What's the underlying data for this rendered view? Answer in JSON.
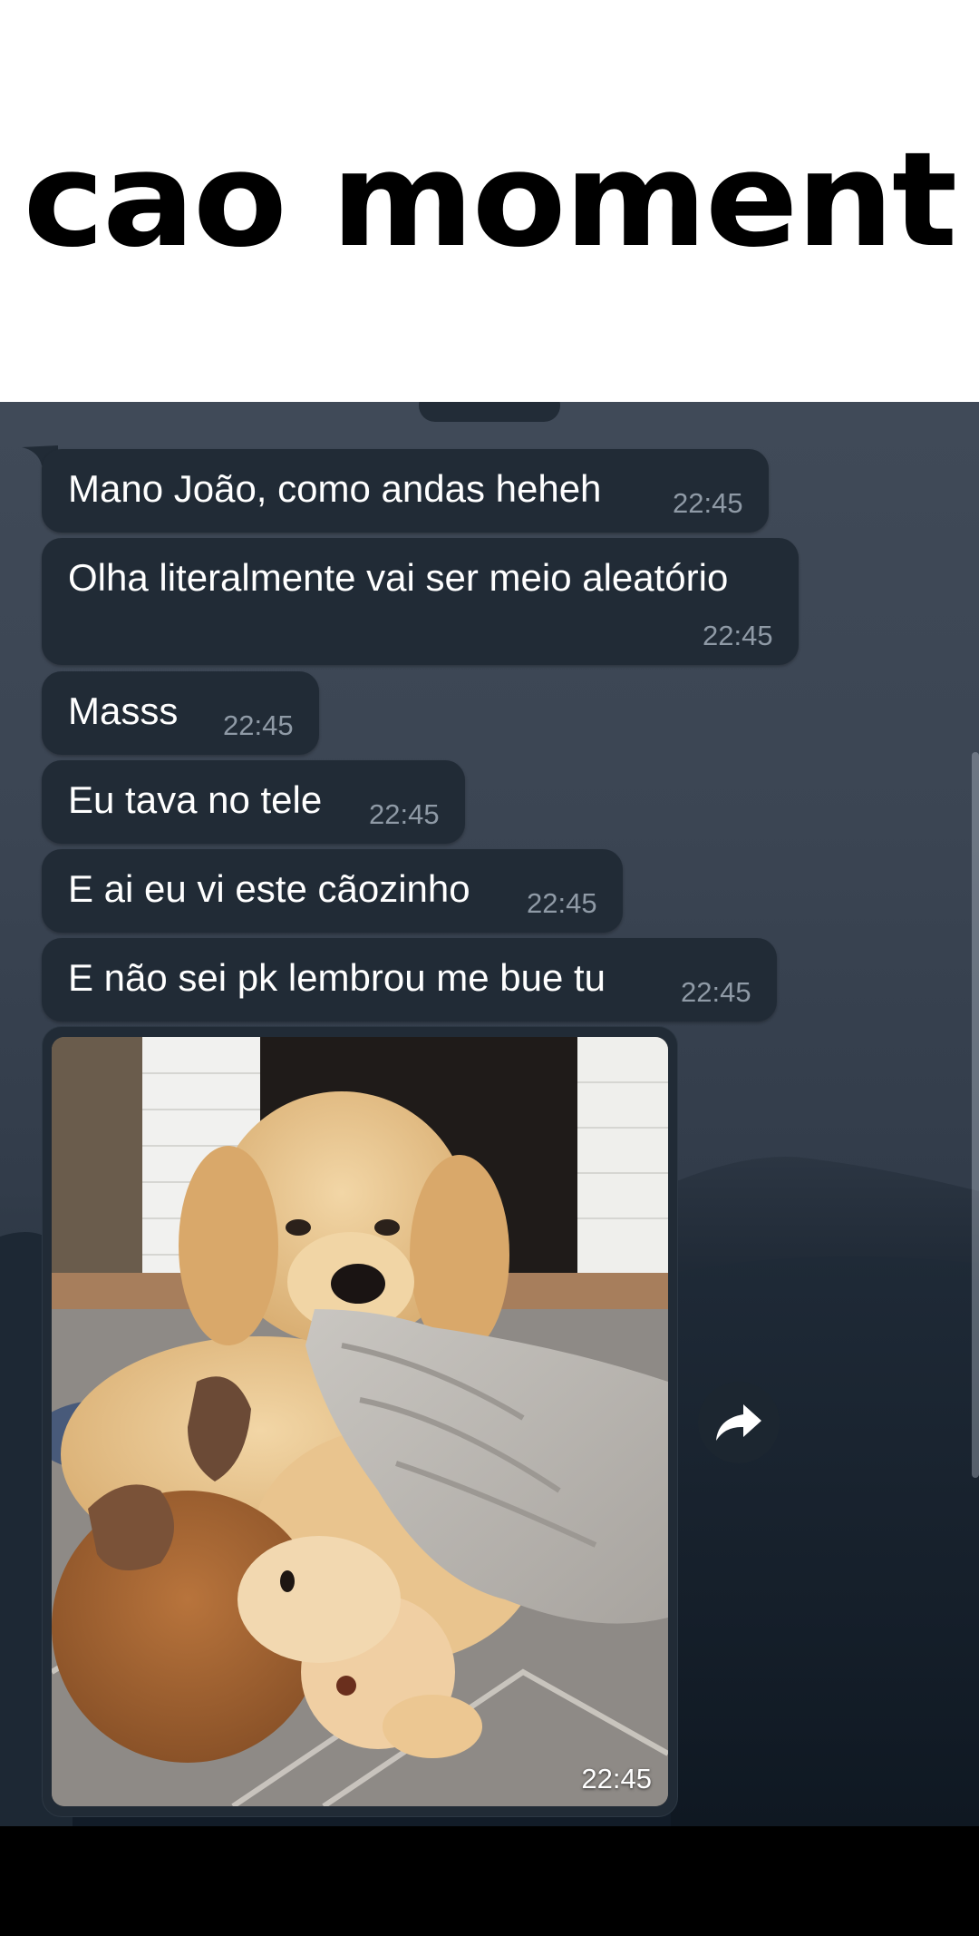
{
  "meme": {
    "title": "cao moment"
  },
  "chat": {
    "messages": [
      {
        "text": "Mano João, como andas heheh",
        "time": "22:45"
      },
      {
        "text": "Olha literalmente vai ser meio aleatório",
        "time": "22:45"
      },
      {
        "text": "Masss",
        "time": "22:45"
      },
      {
        "text": "Eu tava no tele",
        "time": "22:45"
      },
      {
        "text": "E ai eu vi este cãozinho",
        "time": "22:45"
      },
      {
        "text": "E  não sei pk lembrou me bue tu",
        "time": "22:45"
      }
    ],
    "photo": {
      "time": "22:45",
      "subject": "golden retriever puppy with blanket and plush moose"
    }
  },
  "icons": {
    "share": "share-forward-icon"
  },
  "colors": {
    "bubble": "#212b36",
    "timestamp": "#8f9aa6",
    "header_bg": "#ffffff"
  }
}
